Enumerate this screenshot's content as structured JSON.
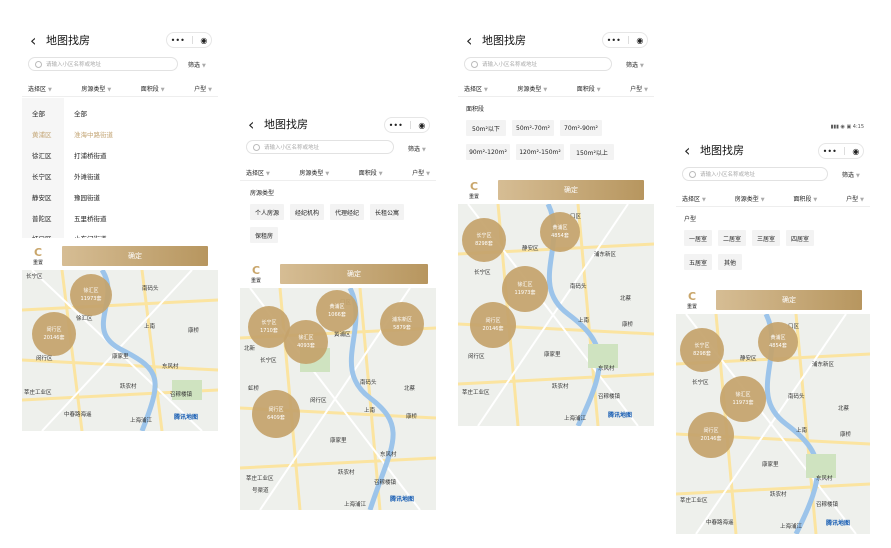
{
  "common": {
    "back_icon": "back-chevron-icon",
    "title": "地图找房",
    "more": "•••",
    "target": "◉",
    "search_placeholder": "请输入小区名称或地址",
    "filter": "筛选",
    "tabs": [
      "选择区",
      "房源类型",
      "面积段",
      "户型"
    ],
    "reset": "重置",
    "confirm": "确定",
    "map_logo": "腾讯地图"
  },
  "screen1": {
    "districts": [
      "全部",
      "黄浦区",
      "徐汇区",
      "长宁区",
      "静安区",
      "普陀区",
      "虹口区"
    ],
    "streets": [
      "全部",
      "淮海中路街道",
      "打浦桥街道",
      "外滩街道",
      "豫园街道",
      "五里桥街道",
      "小东门街道"
    ],
    "active_index": 1,
    "bubbles": [
      {
        "name": "徐汇区",
        "count": "11973套"
      },
      {
        "name": "闵行区",
        "count": "20146套"
      }
    ],
    "map_labels": [
      "长宁区",
      "南码头",
      "徐汇区",
      "上南",
      "康桥",
      "闵行区",
      "康家里",
      "东风村",
      "莘庄工业区",
      "跃农村",
      "召稼楼镇",
      "中春路海遥",
      "上海浦江"
    ]
  },
  "screen2": {
    "section": "房源类型",
    "chips": [
      "个人房源",
      "经纪机构",
      "代理经纪",
      "长租公寓",
      "保租房"
    ],
    "bubbles": [
      {
        "name": "黄浦区",
        "count": "1066套"
      },
      {
        "name": "长宁区",
        "count": "1710套"
      },
      {
        "name": "浦东新区",
        "count": "5879套"
      },
      {
        "name": "徐汇区",
        "count": "4093套"
      },
      {
        "name": "闵行区",
        "count": "6409套"
      }
    ],
    "map_labels": [
      "口区",
      "黄浦区",
      "北新",
      "长宁区",
      "虹桥",
      "南码头",
      "闵行区",
      "北蔡",
      "上南",
      "康桥",
      "康家里",
      "东风村",
      "莘庄工业区",
      "跃农村",
      "召稼楼镇",
      "上海浦江",
      "号渠道"
    ]
  },
  "screen3": {
    "section": "面积段",
    "chips": [
      "50m²以下",
      "50m²-70m²",
      "70m²-90m²",
      "90m²-120m²",
      "120m²-150m²",
      "150m²以上"
    ],
    "bubbles": [
      {
        "name": "长宁区",
        "count": "8298套"
      },
      {
        "name": "黄浦区",
        "count": "4854套"
      },
      {
        "name": "徐汇区",
        "count": "11973套"
      },
      {
        "name": "闵行区",
        "count": "20146套"
      }
    ],
    "map_labels": [
      "口区",
      "静安区",
      "浦东新区",
      "长宁区",
      "南码头",
      "北蔡",
      "康桥",
      "闵行区",
      "上南",
      "康家里",
      "东风村",
      "莘庄工业区",
      "跃农村",
      "召稼楼镇",
      "上海浦江"
    ]
  },
  "screen4": {
    "status": "4:15",
    "section": "户型",
    "chips": [
      "一居室",
      "二居室",
      "三居室",
      "四居室",
      "五居室",
      "其他"
    ],
    "bubbles": [
      {
        "name": "长宁区",
        "count": "8298套"
      },
      {
        "name": "黄浦区",
        "count": "4854套"
      },
      {
        "name": "徐汇区",
        "count": "11973套"
      },
      {
        "name": "闵行区",
        "count": "20146套"
      }
    ],
    "map_labels": [
      "口区",
      "静安区",
      "浦东新区",
      "长宁区",
      "南码头",
      "北蔡",
      "康桥",
      "上南",
      "康家里",
      "东风村",
      "莘庄工业区",
      "跃农村",
      "召稼楼镇",
      "中春路海遥",
      "上海浦江"
    ]
  },
  "colors": {
    "accent": "#c3a575",
    "button_start": "#d6bd94",
    "button_end": "#b7965f",
    "bubble": "#c4a36b"
  }
}
